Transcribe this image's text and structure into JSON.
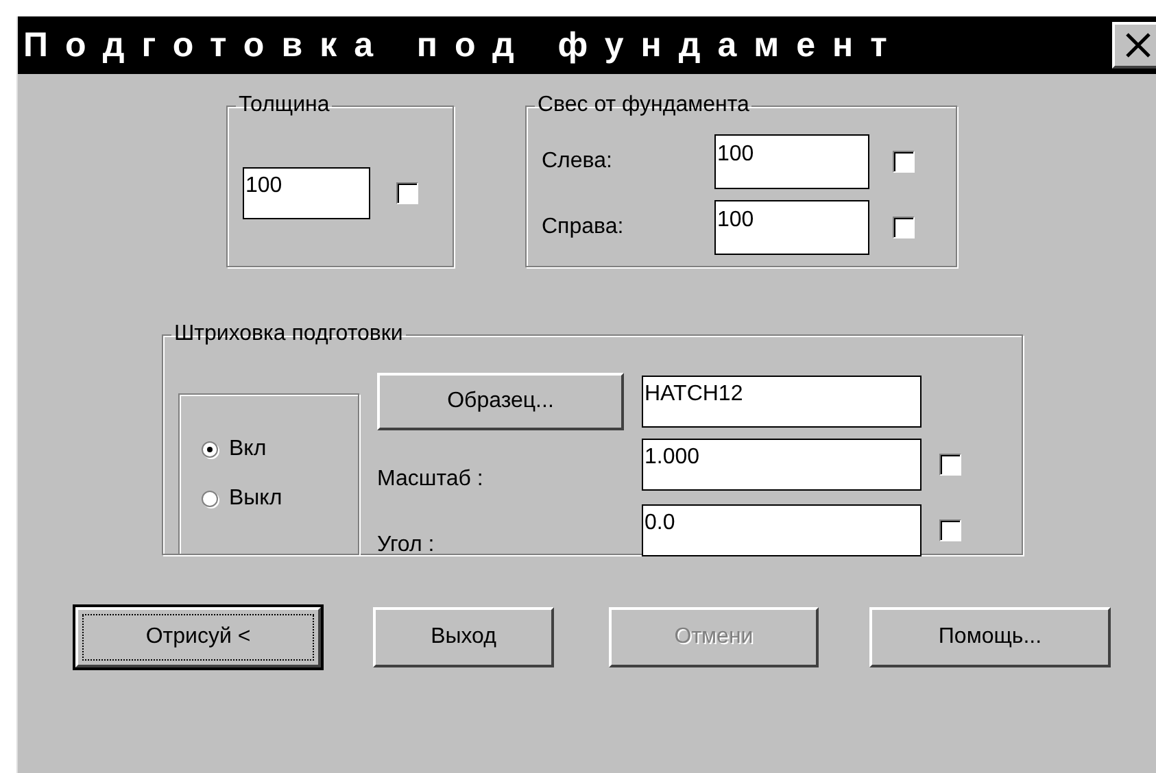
{
  "window": {
    "title": "Подготовка под фундамент"
  },
  "thickness": {
    "label": "Толщина",
    "value": "100",
    "checked": false
  },
  "overhang": {
    "label": "Свес от фундамента",
    "fields": [
      {
        "label": "Слева:",
        "value": "100",
        "checked": false
      },
      {
        "label": "Справа:",
        "value": "100",
        "checked": false
      }
    ]
  },
  "hatch": {
    "label": "Штриховка подготовки",
    "options": [
      {
        "label": "Вкл",
        "selected": true
      },
      {
        "label": "Выкл",
        "selected": false
      }
    ],
    "pattern_button": "Образец...",
    "pattern": "HATCH12",
    "fields": [
      {
        "label": "Масштаб :",
        "value": "1.000",
        "checked": false
      },
      {
        "label": "Угол :",
        "value": "0.0",
        "checked": false
      }
    ]
  },
  "buttons": [
    {
      "label": "Отрисуй <",
      "default": true,
      "disabled": false
    },
    {
      "label": "Выход",
      "default": false,
      "disabled": false
    },
    {
      "label": "Отмени",
      "default": false,
      "disabled": true
    },
    {
      "label": "Помощь...",
      "default": false,
      "disabled": false
    }
  ]
}
